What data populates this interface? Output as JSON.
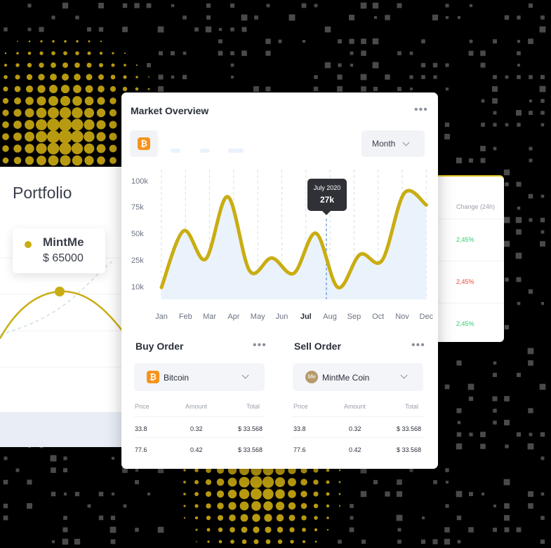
{
  "portfolio": {
    "title": "Portfolio",
    "tooltip": {
      "name": "MintMe",
      "value": "$ 65000"
    }
  },
  "change_panel": {
    "header": "Change (24h)",
    "values": [
      "2,45%",
      "2,45%",
      "2,45%"
    ],
    "value_colors": [
      "#2ecc71",
      "#e74c3c",
      "#2ecc71"
    ]
  },
  "market": {
    "title": "Market Overview",
    "coin_icon": "bitcoin-icon",
    "period": "Month",
    "tooltip": {
      "label": "July 2020",
      "value": "27k"
    }
  },
  "chart_data": {
    "type": "area",
    "categories": [
      "Jan",
      "Feb",
      "Mar",
      "Apr",
      "May",
      "Jun",
      "Jul",
      "Aug",
      "Sep",
      "Oct",
      "Nov",
      "Dec"
    ],
    "ytick_labels": [
      "100k",
      "75k",
      "50k",
      "25k",
      "10k"
    ],
    "ytick_values": [
      100,
      75,
      50,
      25,
      10
    ],
    "ylim": [
      0,
      100
    ],
    "highlight_category": "Jul",
    "series": [
      {
        "values": [
          10,
          58,
          34,
          87,
          24,
          35,
          22,
          56,
          10,
          38,
          33,
          90,
          80
        ]
      }
    ],
    "line_color": "#c9ad12",
    "fill_color": "#eaf2fc",
    "grid": true
  },
  "buy_order": {
    "title": "Buy Order",
    "coin": "Bitcoin",
    "columns": [
      "Price",
      "Amount",
      "Total"
    ],
    "rows": [
      [
        "33.8",
        "0.32",
        "$ 33.568"
      ],
      [
        "77.6",
        "0.42",
        "$ 33.568"
      ]
    ]
  },
  "sell_order": {
    "title": "Sell Order",
    "coin": "MintMe Coin",
    "coin_mark": "Me",
    "columns": [
      "Price",
      "Amount",
      "Total"
    ],
    "rows": [
      [
        "33.8",
        "0.32",
        "$ 33.568"
      ],
      [
        "77.6",
        "0.42",
        "$ 33.568"
      ]
    ]
  },
  "colors": {
    "accent": "#c9ad12",
    "bitcoin": "#f7931a",
    "tooltip_bg": "#2f3136"
  }
}
